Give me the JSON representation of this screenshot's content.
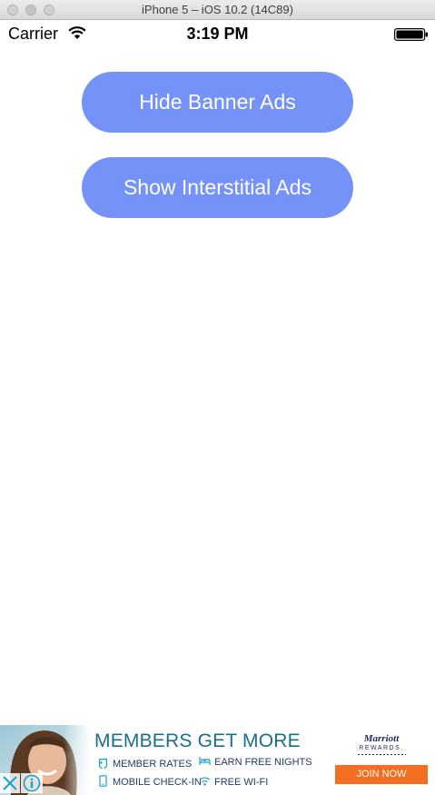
{
  "window": {
    "title": "iPhone 5 – iOS 10.2 (14C89)"
  },
  "status_bar": {
    "carrier": "Carrier",
    "time": "3:19 PM",
    "wifi_icon": "wifi-icon",
    "battery_icon": "battery-icon"
  },
  "buttons": {
    "hide_banner": "Hide Banner Ads",
    "show_interstitial": "Show Interstitial Ads"
  },
  "banner_ad": {
    "headline": "MEMBERS GET MORE",
    "features": [
      {
        "label": "MEMBER RATES",
        "icon": "tag-icon"
      },
      {
        "label": "EARN FREE NIGHTS",
        "icon": "bed-icon"
      },
      {
        "label": "MOBILE CHECK-IN",
        "icon": "phone-icon"
      },
      {
        "label": "FREE WI-FI",
        "icon": "wifi-icon"
      }
    ],
    "brand": "Marriott",
    "brand_sub": "REWARDS.",
    "cta": "JOIN NOW",
    "close_icon": "close-icon",
    "info_icon": "info-icon"
  },
  "colors": {
    "button_bg": "#7592f9",
    "button_text": "#ffffff",
    "ad_headline": "#1a6e8c",
    "ad_cta": "#f36f21",
    "ad_brand": "#1b2a5a",
    "ad_control": "#1aa0c8"
  }
}
